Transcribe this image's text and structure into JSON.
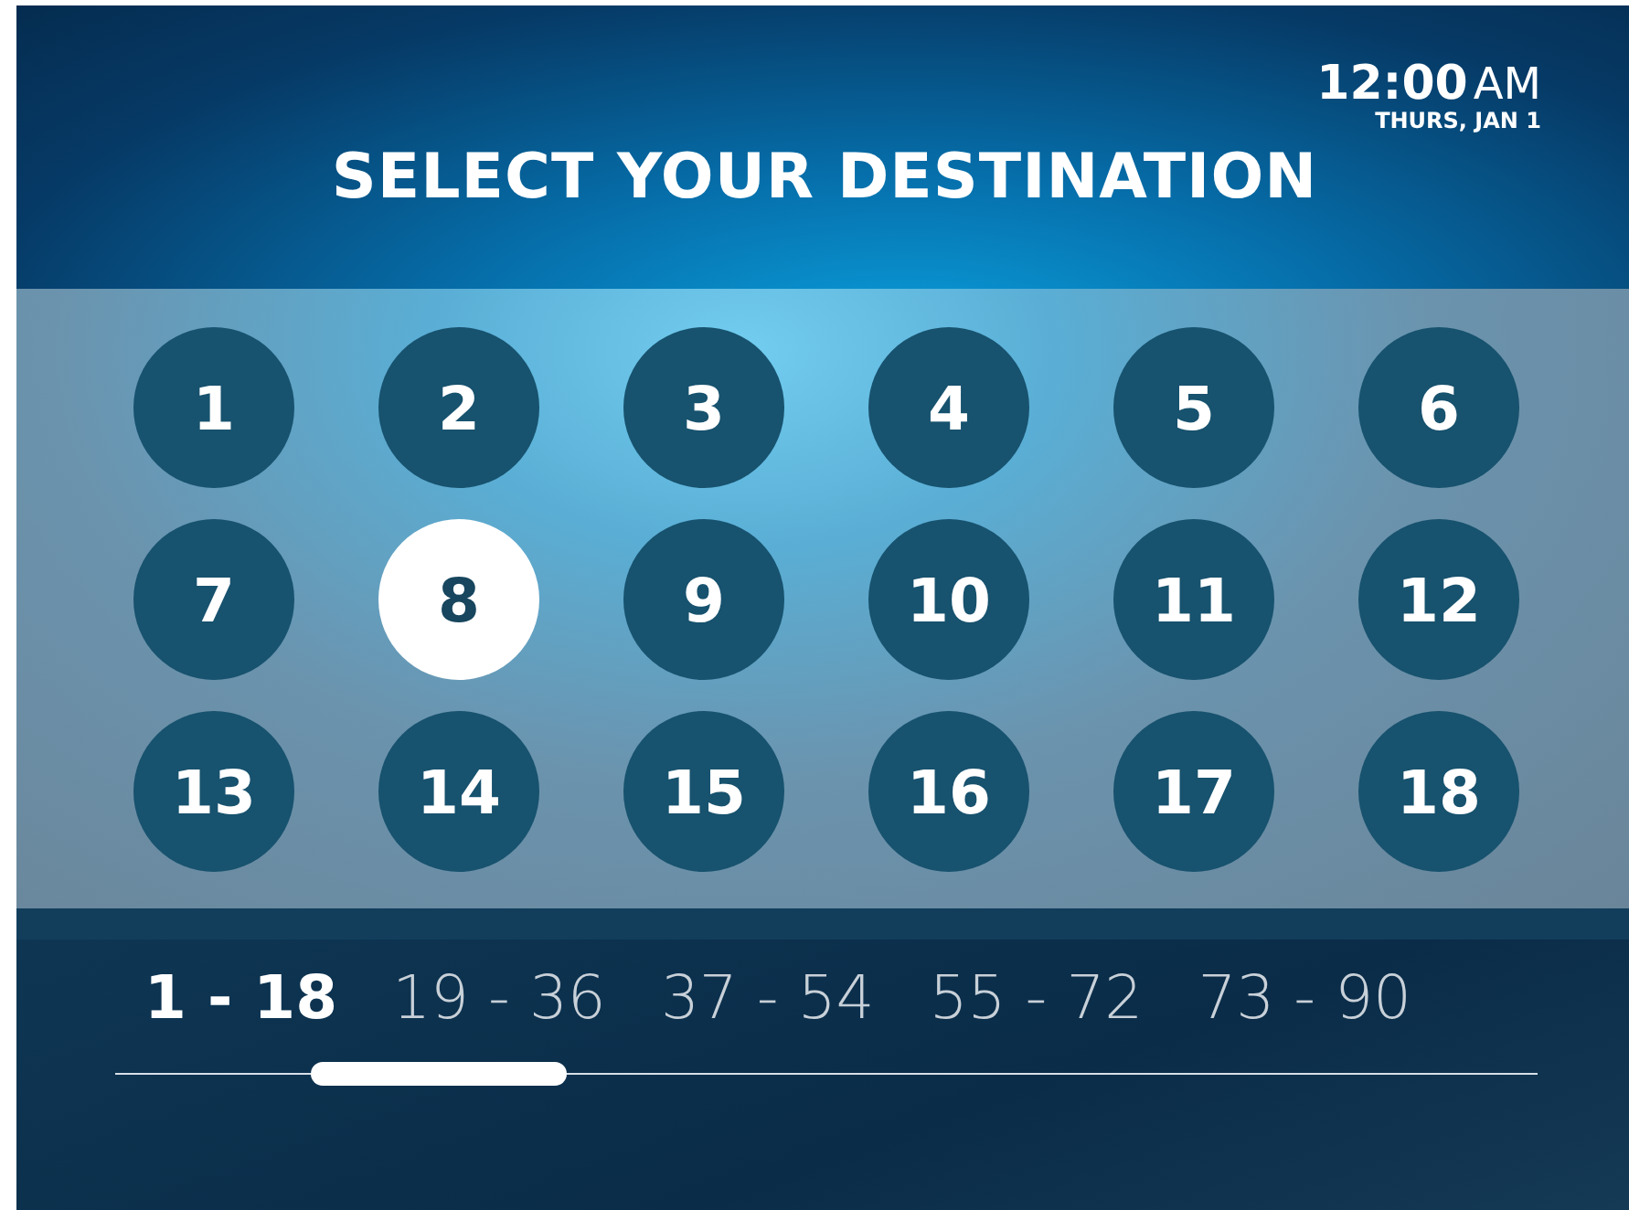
{
  "clock": {
    "time": "12:00",
    "meridiem": "AM",
    "date": "THURS, JAN 1"
  },
  "title": "SELECT YOUR DESTINATION",
  "destinations": [
    {
      "label": "1",
      "selected": false
    },
    {
      "label": "2",
      "selected": false
    },
    {
      "label": "3",
      "selected": false
    },
    {
      "label": "4",
      "selected": false
    },
    {
      "label": "5",
      "selected": false
    },
    {
      "label": "6",
      "selected": false
    },
    {
      "label": "7",
      "selected": false
    },
    {
      "label": "8",
      "selected": true
    },
    {
      "label": "9",
      "selected": false
    },
    {
      "label": "10",
      "selected": false
    },
    {
      "label": "11",
      "selected": false
    },
    {
      "label": "12",
      "selected": false
    },
    {
      "label": "13",
      "selected": false
    },
    {
      "label": "14",
      "selected": false
    },
    {
      "label": "15",
      "selected": false
    },
    {
      "label": "16",
      "selected": false
    },
    {
      "label": "17",
      "selected": false
    },
    {
      "label": "18",
      "selected": false
    }
  ],
  "ranges": [
    {
      "label": "1 - 18",
      "selected": true
    },
    {
      "label": "19 - 36",
      "selected": false
    },
    {
      "label": "37 - 54",
      "selected": false
    },
    {
      "label": "55 - 72",
      "selected": false
    },
    {
      "label": "73 - 90",
      "selected": false
    }
  ]
}
